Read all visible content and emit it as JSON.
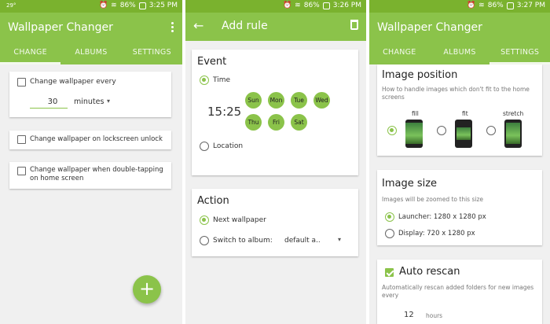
{
  "status": {
    "left_text": "29°",
    "battery_pct": [
      "86%",
      "86%",
      "86%"
    ],
    "times": [
      "3:25 PM",
      "3:26 PM",
      "3:27 PM"
    ]
  },
  "screen1": {
    "title": "Wallpaper Changer",
    "tabs": [
      "CHANGE",
      "ALBUMS",
      "SETTINGS"
    ],
    "interval_label": "Change wallpaper every",
    "interval_value": "30",
    "interval_unit": "minutes",
    "lockscreen_label": "Change wallpaper on lockscreen unlock",
    "doubletap_label": "Change wallpaper when double-tapping on home screen"
  },
  "screen2": {
    "title": "Add rule",
    "event_heading": "Event",
    "time_option": "Time",
    "time_value": "15:25",
    "days": [
      "Sun",
      "Mon",
      "Tue",
      "Wed",
      "Thu",
      "Fri",
      "Sat"
    ],
    "location_option": "Location",
    "action_heading": "Action",
    "next_wallpaper_option": "Next wallpaper",
    "switch_album_option": "Switch to album:",
    "album_value": "default a.."
  },
  "screen3": {
    "title": "Wallpaper Changer",
    "tabs": [
      "CHANGE",
      "ALBUMS",
      "SETTINGS"
    ],
    "image_position_heading": "Image position",
    "image_position_desc": "How to handle images which don't fit to the home screens",
    "position_options": [
      "fill",
      "fit",
      "stretch"
    ],
    "image_size_heading": "Image size",
    "image_size_desc": "Images will be zoomed to this size",
    "launcher_option": "Launcher: 1280 x 1280 px",
    "display_option": "Display: 720 x 1280 px",
    "auto_rescan_heading": "Auto rescan",
    "auto_rescan_desc": "Automatically rescan added folders for new images every",
    "rescan_value": "12",
    "rescan_unit": "hours"
  },
  "colors": {
    "primary": "#8bc34a",
    "status": "#7ab22e"
  }
}
